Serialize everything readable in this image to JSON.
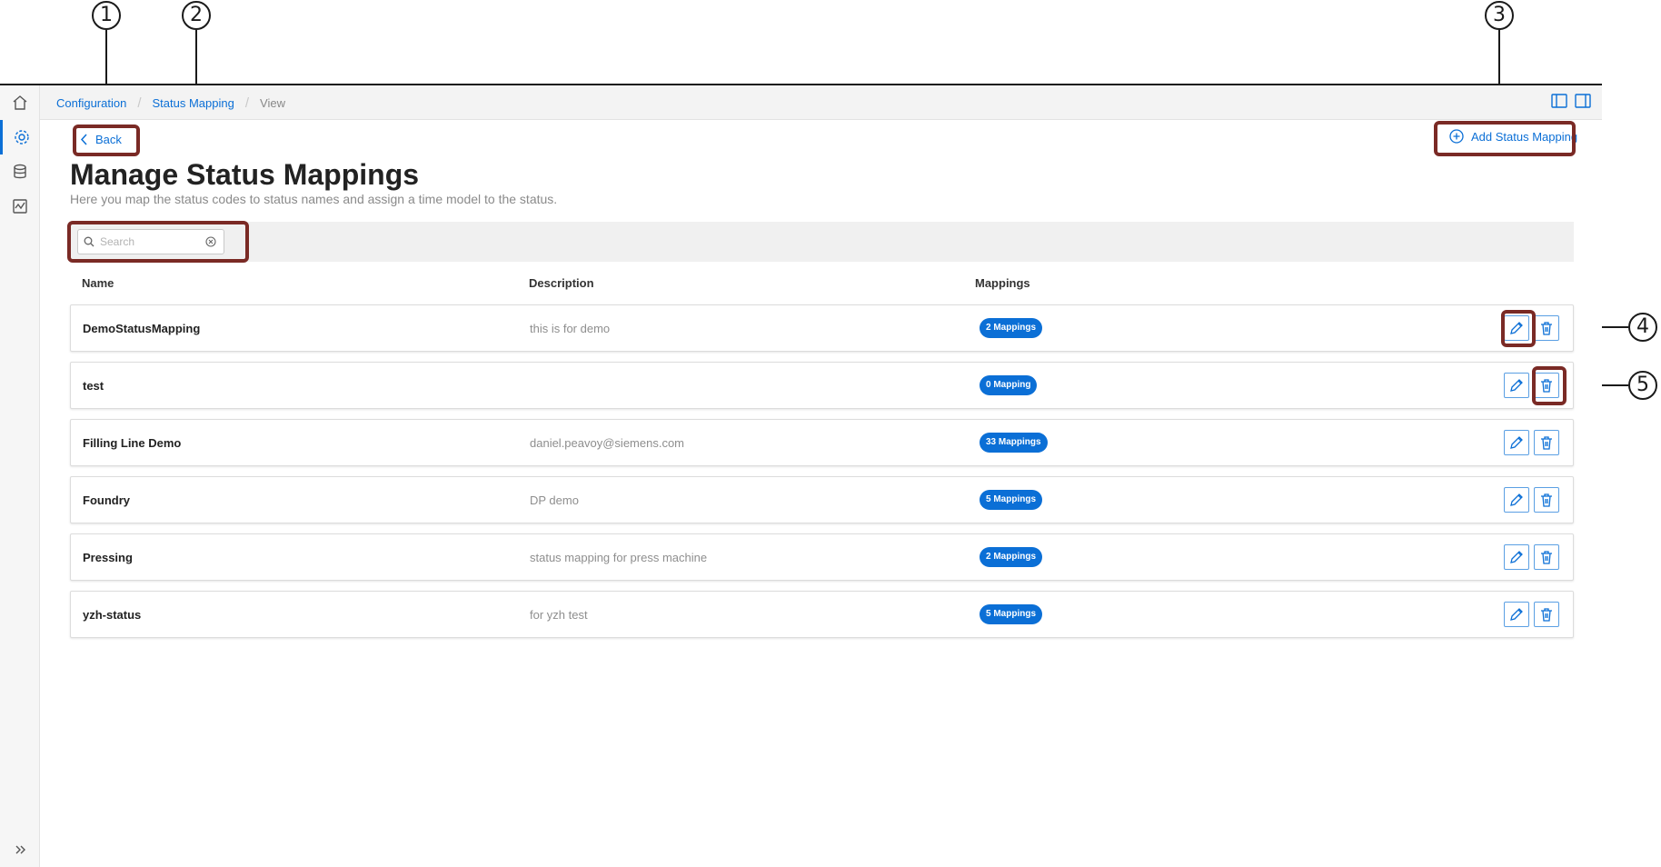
{
  "callouts": [
    "1",
    "2",
    "3",
    "4",
    "5"
  ],
  "breadcrumb": {
    "items": [
      "Configuration",
      "Status Mapping",
      "View"
    ]
  },
  "back_label": "Back",
  "add_button_label": "Add Status Mapping",
  "title": "Manage Status Mappings",
  "subtitle": "Here you map the status codes to status names and assign a time model to the status.",
  "search": {
    "placeholder": "Search",
    "value": ""
  },
  "columns": {
    "name": "Name",
    "description": "Description",
    "mappings": "Mappings"
  },
  "rows": [
    {
      "name": "DemoStatusMapping",
      "description": "this is for demo",
      "mappings": "2 Mappings"
    },
    {
      "name": "test",
      "description": "",
      "mappings": "0 Mapping"
    },
    {
      "name": "Filling Line Demo",
      "description": "daniel.peavoy@siemens.com",
      "mappings": "33 Mappings"
    },
    {
      "name": "Foundry",
      "description": "DP demo",
      "mappings": "5 Mappings"
    },
    {
      "name": "Pressing",
      "description": "status mapping for press machine",
      "mappings": "2 Mappings"
    },
    {
      "name": "yzh-status",
      "description": "for yzh test",
      "mappings": "5 Mappings"
    }
  ],
  "colors": {
    "accent": "#0b6fd6",
    "highlight": "#7a2a25"
  },
  "icons": [
    "home-icon",
    "settings-icon",
    "database-icon",
    "chart-icon",
    "expand-icon",
    "back-chevron-icon",
    "add-circle-icon",
    "search-icon",
    "clear-icon",
    "edit-icon",
    "delete-icon"
  ]
}
